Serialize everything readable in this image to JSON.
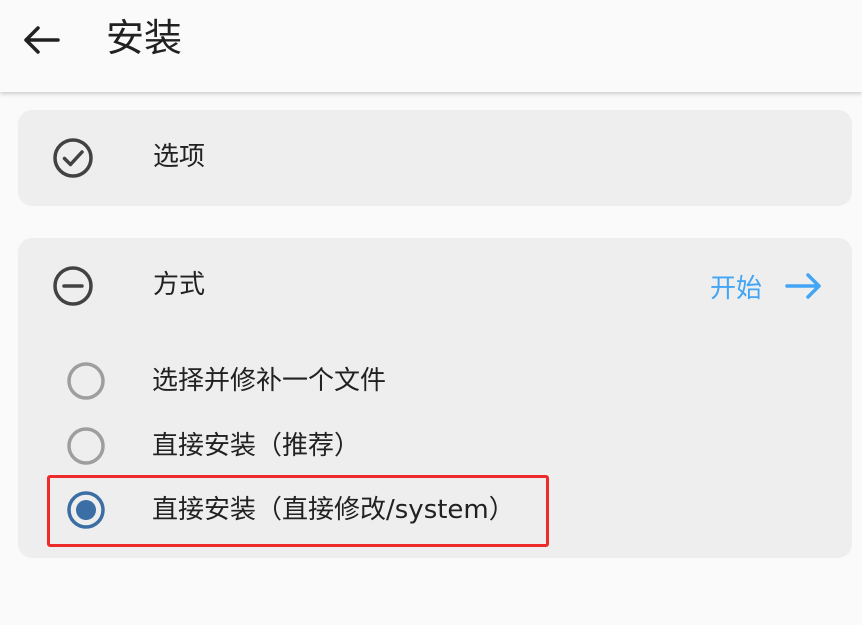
{
  "appbar": {
    "title": "安装"
  },
  "options_card": {
    "label": "选项"
  },
  "method_card": {
    "label": "方式",
    "start_label": "开始",
    "accent_color": "#42a5f5",
    "choices": [
      {
        "label": "选择并修补一个文件",
        "selected": false
      },
      {
        "label": "直接安装（推荐）",
        "selected": false
      },
      {
        "label": "直接安装（直接修改/system）",
        "selected": true
      }
    ]
  },
  "icons": {
    "back": "arrow-back-icon",
    "options": "check-circle-icon",
    "method": "minus-circle-icon",
    "start": "arrow-forward-icon"
  },
  "highlight_color": "#ee2b2b"
}
